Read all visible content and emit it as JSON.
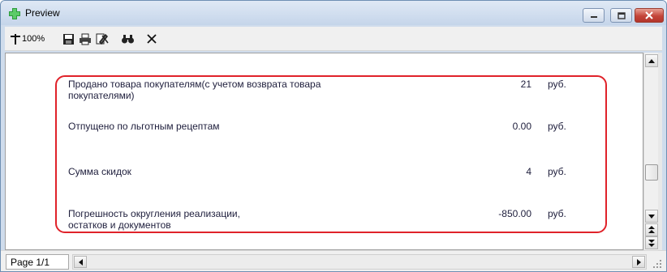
{
  "window": {
    "title": "Preview"
  },
  "toolbar": {
    "zoom_label": "100%"
  },
  "report": {
    "rows": [
      {
        "label_line1": "Продано товара покупателям(с учетом возврата товара",
        "label_line2": "покупателями)",
        "value": "21",
        "unit": "руб."
      },
      {
        "label_line1": "Отпущено по льготным рецептам",
        "label_line2": "",
        "value": "0.00",
        "unit": "руб."
      },
      {
        "label_line1": "Сумма скидок",
        "label_line2": "",
        "value": "4",
        "unit": "руб."
      },
      {
        "label_line1": "Погрешность округления реализации,",
        "label_line2": "остатков и документов",
        "value": "-850.00",
        "unit": "руб."
      }
    ]
  },
  "status": {
    "page_label": "Page 1/1"
  },
  "colors": {
    "highlight": "#e0222a",
    "titlebar": "#c5d5ea"
  },
  "icons": [
    "app-icon",
    "zoom-icon",
    "save-icon",
    "print-icon",
    "page-setup-icon",
    "find-icon",
    "close-preview-icon"
  ]
}
